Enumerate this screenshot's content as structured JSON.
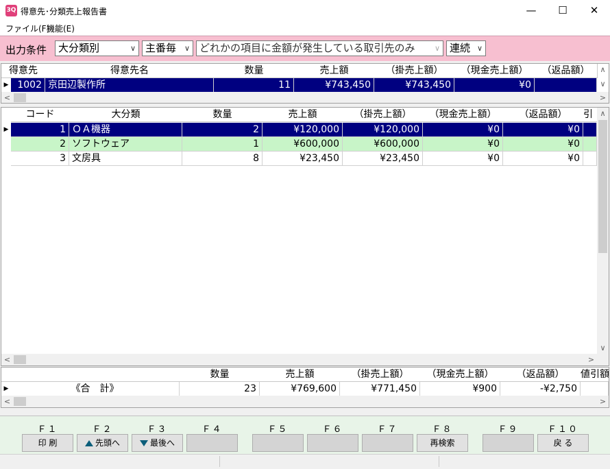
{
  "window": {
    "title": "得意先･分類売上報告書",
    "icon_text": "3Q",
    "minimize": "—",
    "maximize": "☐",
    "close": "✕"
  },
  "menu": [
    {
      "label": "ファイル(F)"
    },
    {
      "label": "機能(E)"
    }
  ],
  "conditions": {
    "label": "出力条件",
    "classification": "大分類別",
    "per": "主番毎",
    "filter": "どれかの項目に金額が発生している取引先のみ",
    "mode": "連続"
  },
  "customer_grid": {
    "headers": [
      "得意先",
      "得意先名",
      "数量",
      "売上額",
      "（掛売上額）",
      "（現金売上額）",
      "（返品額）"
    ],
    "rows": [
      {
        "code": "1002",
        "name": "京田辺製作所",
        "qty": "11",
        "sales": "¥743,450",
        "credit": "¥743,450",
        "cash": "¥0",
        "returns": ""
      }
    ]
  },
  "category_grid": {
    "headers": [
      "コード",
      "大分類",
      "数量",
      "売上額",
      "（掛売上額）",
      "（現金売上額）",
      "（返品額）",
      "引"
    ],
    "rows": [
      {
        "code": "1",
        "name": "ＯＡ機器",
        "qty": "2",
        "sales": "¥120,000",
        "credit": "¥120,000",
        "cash": "¥0",
        "returns": "¥0"
      },
      {
        "code": "2",
        "name": "ソフトウェア",
        "qty": "1",
        "sales": "¥600,000",
        "credit": "¥600,000",
        "cash": "¥0",
        "returns": "¥0"
      },
      {
        "code": "3",
        "name": "文房具",
        "qty": "8",
        "sales": "¥23,450",
        "credit": "¥23,450",
        "cash": "¥0",
        "returns": "¥0"
      }
    ]
  },
  "total_grid": {
    "headers": [
      "数量",
      "売上額",
      "（掛売上額）",
      "（現金売上額）",
      "（返品額）",
      "値引額"
    ],
    "row": {
      "label": "《合　計》",
      "qty": "23",
      "sales": "¥769,600",
      "credit": "¥771,450",
      "cash": "¥900",
      "returns": "-¥2,750"
    }
  },
  "function_keys": [
    {
      "key": "Ｆ１",
      "label": "印 刷"
    },
    {
      "key": "Ｆ２",
      "label": "先頭へ"
    },
    {
      "key": "Ｆ３",
      "label": "最後へ"
    },
    {
      "key": "Ｆ４",
      "label": ""
    },
    {
      "key": "Ｆ５",
      "label": ""
    },
    {
      "key": "Ｆ６",
      "label": ""
    },
    {
      "key": "Ｆ７",
      "label": ""
    },
    {
      "key": "Ｆ８",
      "label": "再検索"
    },
    {
      "key": "Ｆ９",
      "label": ""
    },
    {
      "key": "Ｆ１０",
      "label": "戻 る"
    }
  ]
}
